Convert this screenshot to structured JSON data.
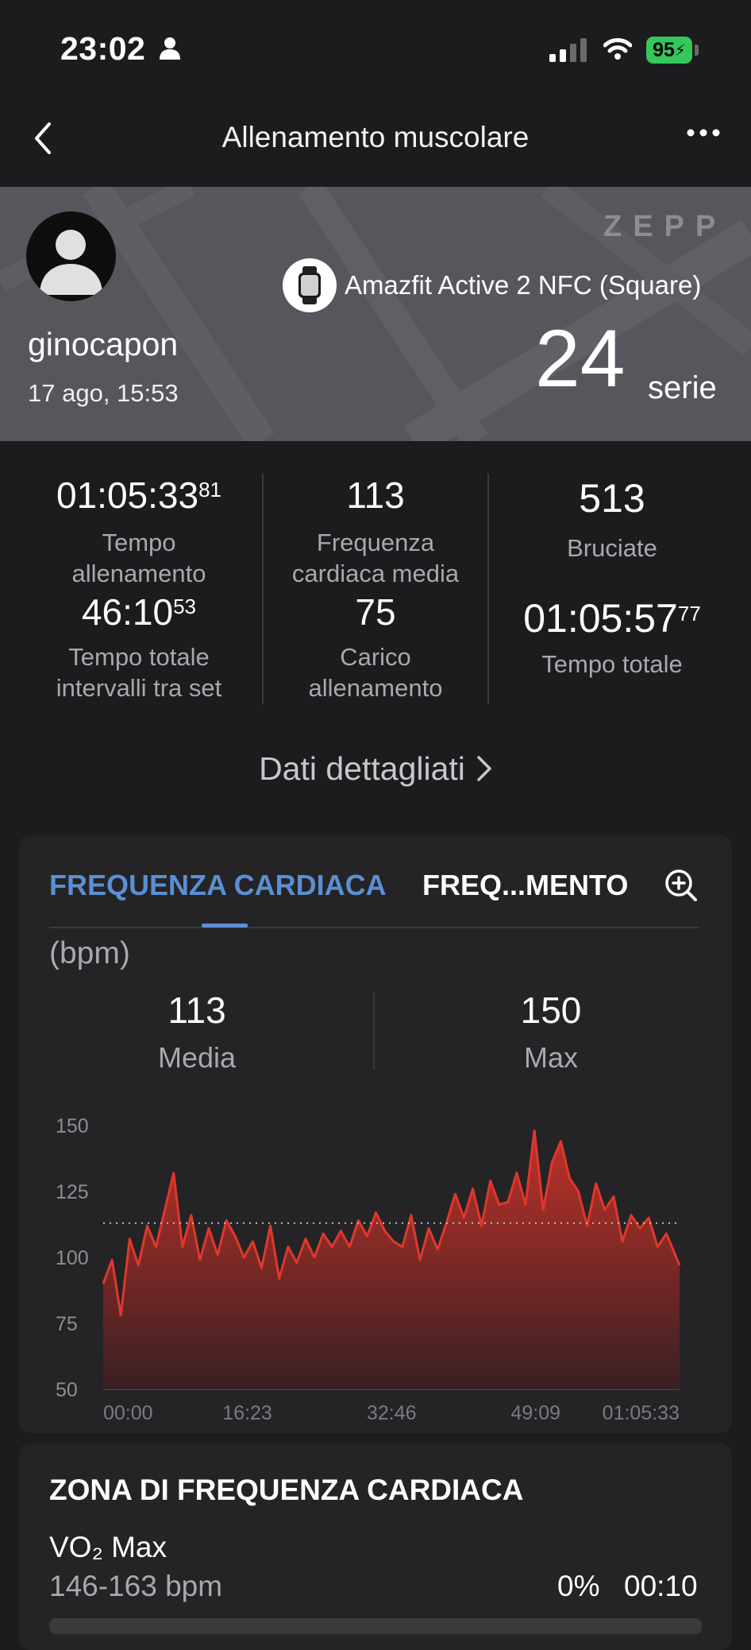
{
  "status_bar": {
    "time": "23:02",
    "battery": "95"
  },
  "nav": {
    "title": "Allenamento muscolare"
  },
  "header": {
    "brand": "ZEPP",
    "username": "ginocapon",
    "date": "17 ago, 15:53",
    "device": "Amazfit Active 2 NFC (Square)",
    "series_value": "24",
    "series_unit": "serie"
  },
  "stats": {
    "c1": {
      "v1": "01:05:33",
      "v1s": "81",
      "l1a": "Tempo",
      "l1b": "allenamento",
      "v2": "46:10",
      "v2s": "53",
      "l2a": "Tempo totale",
      "l2b": "intervalli tra set"
    },
    "c2": {
      "v1": "113",
      "l1a": "Frequenza",
      "l1b": "cardiaca media",
      "v2": "75",
      "l2a": "Carico",
      "l2b": "allenamento"
    },
    "c3": {
      "v1": "513",
      "l1a": "Bruciate",
      "v2": "01:05:57",
      "v2s": "77",
      "l2a": "Tempo totale"
    }
  },
  "details_link": "Dati dettagliati",
  "hr_card": {
    "tab_active": "FREQUENZA CARDIACA",
    "tab_other": "FREQ...MENTO",
    "unit": "(bpm)",
    "avg_value": "113",
    "avg_label": "Media",
    "max_value": "150",
    "max_label": "Max"
  },
  "chart_data": {
    "type": "area",
    "title": "",
    "xlabel": "",
    "ylabel": "(bpm)",
    "ylim": [
      50,
      150
    ],
    "yticks": [
      "150",
      "125",
      "100",
      "75",
      "50"
    ],
    "xticks": [
      "00:00",
      "16:23",
      "32:46",
      "49:09",
      "01:05:33"
    ],
    "reference_line": 113,
    "color": "#e0372c",
    "series": [
      {
        "x_minutes": [
          0,
          1,
          2,
          3,
          4,
          5,
          6,
          7,
          8,
          9,
          10,
          11,
          12,
          13,
          14,
          15,
          16,
          17,
          18,
          19,
          20,
          21,
          22,
          23,
          24,
          25,
          26,
          27,
          28,
          29,
          30,
          31,
          32,
          33,
          34,
          35,
          36,
          37,
          38,
          39,
          40,
          41,
          42,
          43,
          44,
          45,
          46,
          47,
          48,
          49,
          50,
          51,
          52,
          53,
          54,
          55,
          56,
          57,
          58,
          59,
          60,
          61,
          62,
          63,
          64,
          65,
          65.5
        ],
        "values": [
          90,
          99,
          78,
          107,
          97,
          112,
          104,
          118,
          132,
          104,
          116,
          99,
          111,
          101,
          114,
          108,
          100,
          106,
          96,
          112,
          92,
          104,
          98,
          107,
          100,
          109,
          104,
          110,
          104,
          114,
          108,
          117,
          110,
          106,
          104,
          116,
          99,
          111,
          103,
          113,
          124,
          115,
          126,
          112,
          129,
          120,
          121,
          132,
          120,
          148,
          118,
          136,
          144,
          130,
          125,
          112,
          128,
          118,
          123,
          106,
          116,
          111,
          115,
          104,
          109,
          101,
          97
        ]
      }
    ]
  },
  "zone_card": {
    "title": "ZONA DI FREQUENZA CARDIACA",
    "zone_name": "VO₂ Max",
    "zone_range": "146-163 bpm",
    "zone_pct": "0%",
    "zone_duration": "00:10"
  }
}
